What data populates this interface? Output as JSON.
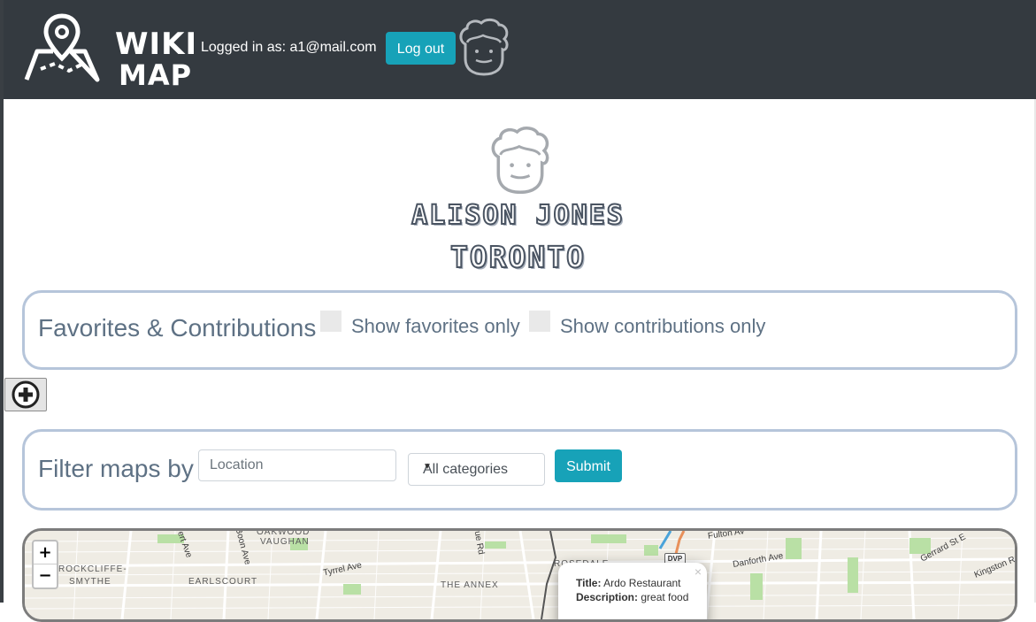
{
  "header": {
    "logo_line1": "WIKI",
    "logo_line2": "MAP",
    "logged_in_text": "Logged in as: a1@mail.com",
    "logout_label": "Log out",
    "background": "#343a40"
  },
  "profile": {
    "name": "ALISON JONES",
    "city": "TORONTO"
  },
  "favorites_panel": {
    "title": "Favorites & Contributions",
    "show_favorites_label": "Show favorites only",
    "show_contributions_label": "Show contributions only"
  },
  "add_button": {
    "icon": "plus-circle-icon"
  },
  "filter_panel": {
    "title": "Filter maps by",
    "location_placeholder": "Location",
    "category_selected": "All categories",
    "submit_label": "Submit"
  },
  "map": {
    "zoom_in": "+",
    "zoom_out": "−",
    "neighborhoods": [
      "ROCKCLIFFE-",
      "SMYTHE",
      "EARLSCOURT",
      "OAKWOOD",
      "VAUGHAN",
      "THE ANNEX",
      "ROSEDALE"
    ],
    "streets": [
      "ert Ave",
      "Boon Ave",
      "Tyrrel Ave",
      "ue Rd",
      "Fulton Av",
      "Danforth Ave",
      "Gerrard St E",
      "Kingston R",
      "DVP"
    ],
    "popup": {
      "title_label": "Title:",
      "title_value": "Ardo Restaurant",
      "description_label": "Description:",
      "description_value": "great food",
      "close": "×"
    }
  },
  "colors": {
    "accent": "#17a2b8",
    "panel_border": "#b6c5da",
    "panel_text": "#5e7184"
  }
}
